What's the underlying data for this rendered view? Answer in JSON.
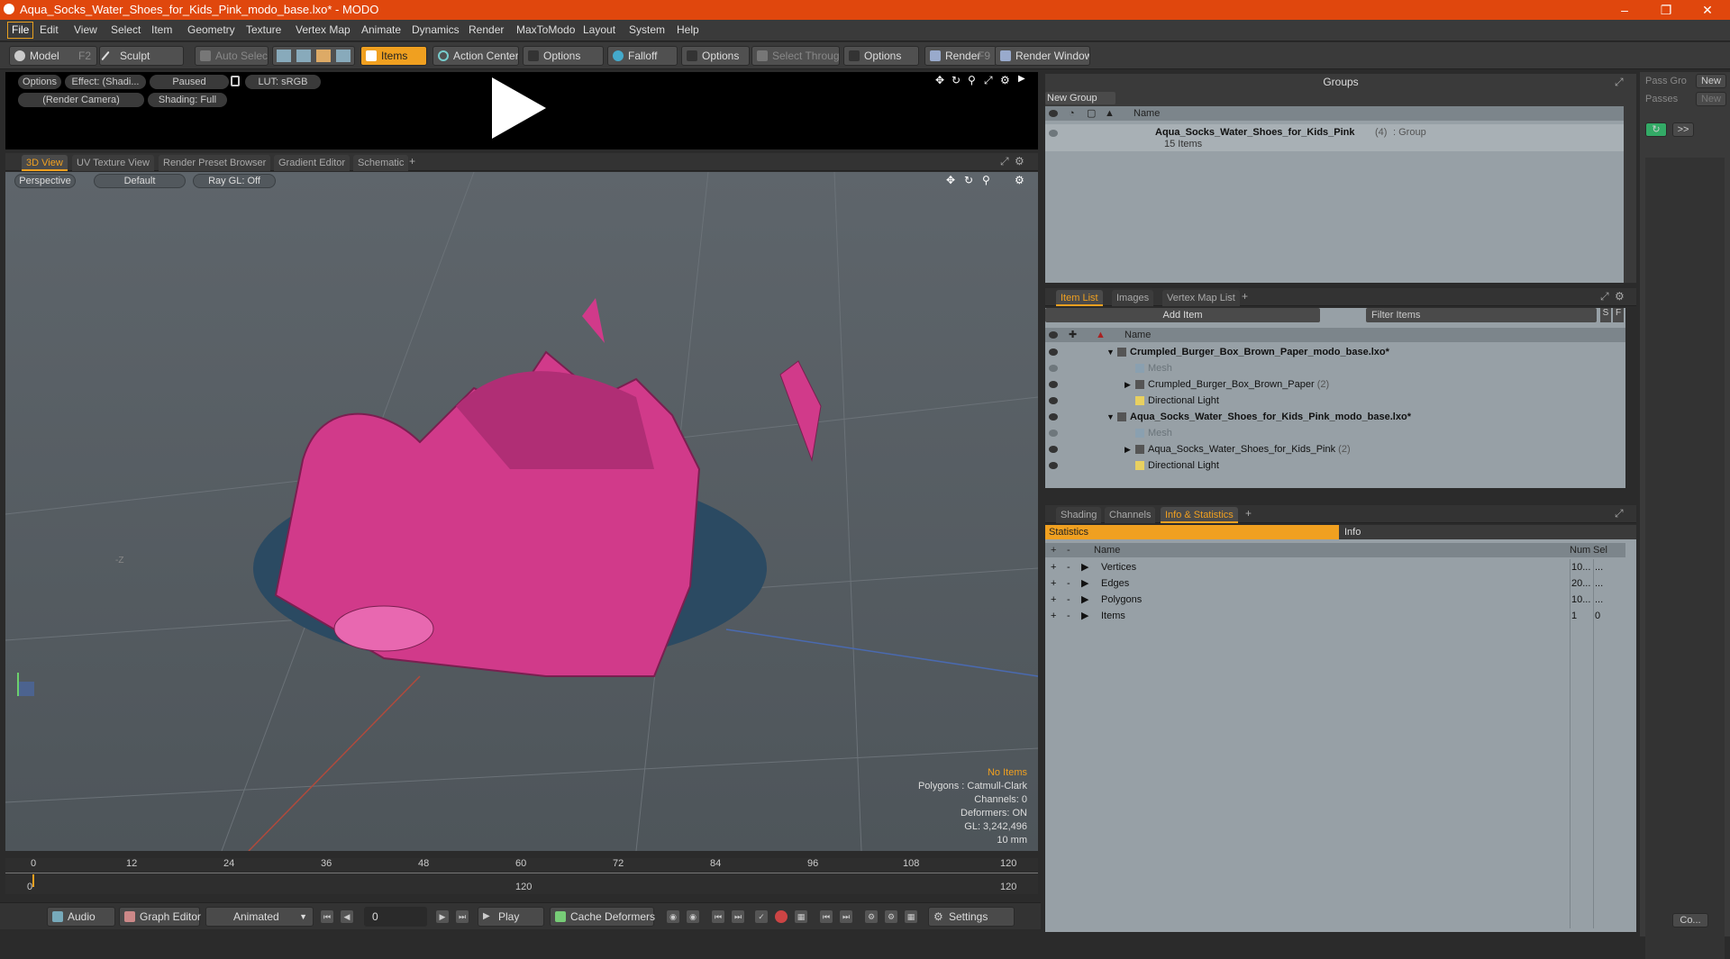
{
  "window": {
    "title": "Aqua_Socks_Water_Shoes_for_Kids_Pink_modo_base.lxo* - MODO"
  },
  "menu": [
    "File",
    "Edit",
    "View",
    "Select",
    "Item",
    "Geometry",
    "Texture",
    "Vertex Map",
    "Animate",
    "Dynamics",
    "Render",
    "MaxToModo",
    "Layout",
    "System",
    "Help"
  ],
  "toolbar": {
    "model": "Model",
    "model_key": "F2",
    "sculpt": "Sculpt",
    "auto_select": "Auto Select",
    "items": "Items",
    "action_center": "Action Center",
    "options1": "Options",
    "falloff": "Falloff",
    "options2": "Options",
    "select_through": "Select Through",
    "options3": "Options",
    "render": "Render",
    "render_key": "F9",
    "render_window": "Render Window"
  },
  "preview": {
    "options": "Options",
    "effect": "Effect: (Shadi...",
    "paused": "Paused",
    "lut": "LUT: sRGB",
    "camera": "(Render Camera)",
    "shading": "Shading: Full"
  },
  "view_tabs": [
    "3D View",
    "UV Texture View",
    "Render Preset Browser",
    "Gradient Editor",
    "Schematic"
  ],
  "viewport": {
    "perspective": "Perspective",
    "default": "Default",
    "raygl": "Ray GL: Off",
    "axis_label": "-Z",
    "stats": {
      "no_items": "No Items",
      "polygons": "Polygons : Catmull-Clark",
      "channels": "Channels: 0",
      "deformers": "Deformers: ON",
      "gl": "GL: 3,242,496",
      "scale": "10 mm"
    }
  },
  "timeline": {
    "ticks": [
      "0",
      "12",
      "24",
      "36",
      "48",
      "60",
      "72",
      "84",
      "96",
      "108",
      "120"
    ],
    "low": [
      "0",
      "120",
      "120"
    ]
  },
  "bottom": {
    "audio": "Audio",
    "graph_editor": "Graph Editor",
    "animated": "Animated",
    "frame": "0",
    "play": "Play",
    "cache": "Cache Deformers",
    "settings": "Settings"
  },
  "groups": {
    "title": "Groups",
    "new_group": "New Group",
    "col_name": "Name",
    "group_name": "Aqua_Socks_Water_Shoes_for_Kids_Pink",
    "group_count": "(4)",
    "group_type": ": Group",
    "group_items": "15 Items"
  },
  "passes": {
    "pass_groups": "Pass Gro",
    "new1": "New",
    "passes": "Passes",
    "new2": "New",
    "arrow": ">>"
  },
  "item_tabs": [
    "Item List",
    "Images",
    "Vertex Map List"
  ],
  "item_list": {
    "add_item": "Add Item",
    "filter": "Filter Items",
    "s": "S",
    "f": "F",
    "col_name": "Name",
    "rows": [
      {
        "label": "Crumpled_Burger_Box_Brown_Paper_modo_base.lxo*",
        "indent": 0,
        "kind": "scene"
      },
      {
        "label": "Mesh",
        "indent": 1,
        "kind": "mesh"
      },
      {
        "label": "Crumpled_Burger_Box_Brown_Paper",
        "count": "(2)",
        "indent": 1,
        "kind": "group"
      },
      {
        "label": "Directional Light",
        "indent": 1,
        "kind": "light"
      },
      {
        "label": "Aqua_Socks_Water_Shoes_for_Kids_Pink_modo_base.lxo*",
        "indent": 0,
        "kind": "scene"
      },
      {
        "label": "Mesh",
        "indent": 1,
        "kind": "mesh"
      },
      {
        "label": "Aqua_Socks_Water_Shoes_for_Kids_Pink",
        "count": "(2)",
        "indent": 1,
        "kind": "group"
      },
      {
        "label": "Directional Light",
        "indent": 1,
        "kind": "light"
      }
    ]
  },
  "info_tabs": [
    "Shading",
    "Channels",
    "Info & Statistics"
  ],
  "stats_panel": {
    "statistics": "Statistics",
    "info": "Info",
    "col_name": "Name",
    "col_num": "Num",
    "col_sel": "Sel",
    "rows": [
      {
        "name": "Vertices",
        "num": "10...",
        "sel": "..."
      },
      {
        "name": "Edges",
        "num": "20...",
        "sel": "..."
      },
      {
        "name": "Polygons",
        "num": "10...",
        "sel": "..."
      },
      {
        "name": "Items",
        "num": "1",
        "sel": "0"
      }
    ]
  },
  "corner": {
    "co": "Co..."
  }
}
